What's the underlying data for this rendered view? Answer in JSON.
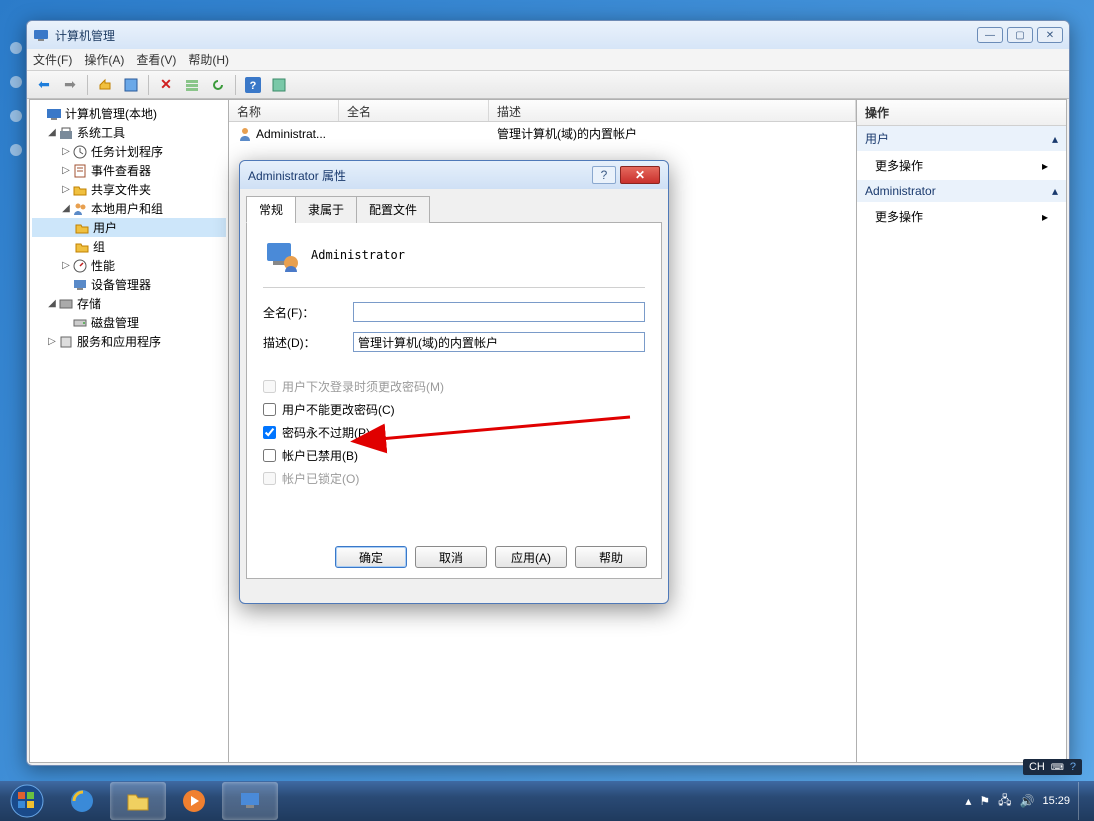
{
  "window": {
    "title": "计算机管理",
    "menu": {
      "file": "文件(F)",
      "action": "操作(A)",
      "view": "查看(V)",
      "help": "帮助(H)"
    }
  },
  "tree": {
    "root": "计算机管理(本地)",
    "systools": "系统工具",
    "tasksched": "任务计划程序",
    "eventvwr": "事件查看器",
    "sharedfolders": "共享文件夹",
    "localusers": "本地用户和组",
    "users": "用户",
    "groups": "组",
    "perf": "性能",
    "devmgr": "设备管理器",
    "storage": "存储",
    "diskmgmt": "磁盘管理",
    "services": "服务和应用程序"
  },
  "list": {
    "col_name": "名称",
    "col_fullname": "全名",
    "col_desc": "描述",
    "row_name": "Administrat...",
    "row_desc": "管理计算机(域)的内置帐户"
  },
  "actions": {
    "header": "操作",
    "section1": "用户",
    "section2": "Administrator",
    "more": "更多操作"
  },
  "dialog": {
    "title": "Administrator 属性",
    "tab_general": "常规",
    "tab_memberof": "隶属于",
    "tab_profile": "配置文件",
    "username": "Administrator",
    "lbl_fullname": "全名(F)：",
    "val_fullname": "",
    "lbl_desc": "描述(D)：",
    "val_desc": "管理计算机(域)的内置帐户",
    "chk_mustchange": "用户下次登录时须更改密码(M)",
    "chk_cannotchange": "用户不能更改密码(C)",
    "chk_neverexpire": "密码永不过期(P)",
    "chk_disabled": "帐户已禁用(B)",
    "chk_locked": "帐户已锁定(O)",
    "btn_ok": "确定",
    "btn_cancel": "取消",
    "btn_apply": "应用(A)",
    "btn_help": "帮助"
  },
  "taskbar": {
    "lang": "CH",
    "time": "15:29"
  }
}
